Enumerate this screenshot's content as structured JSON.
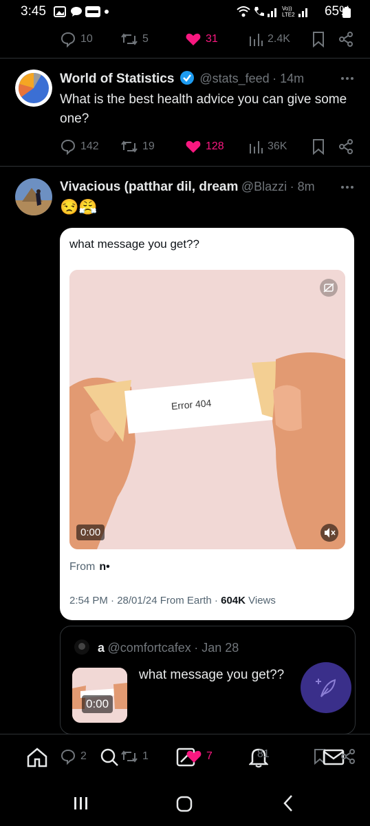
{
  "status_bar": {
    "time": "3:45",
    "battery": "65%"
  },
  "prev_tweet_actions": {
    "replies": "10",
    "retweets": "5",
    "likes": "31",
    "views": "2.4K"
  },
  "tweet1": {
    "name": "World of Statistics",
    "handle": "@stats_feed",
    "time": "· 14m",
    "text": "What is the best health advice you can give some one?",
    "replies": "142",
    "retweets": "19",
    "likes": "128",
    "views": "36K"
  },
  "tweet2": {
    "name": "Vivacious (patthar dil, dream",
    "handle": "@Blazzi",
    "time": "· 8m",
    "emoji": "😒😤",
    "card": {
      "message": "what message you get??",
      "error_text": "Error 404",
      "video_time": "0:00",
      "from_label": "From",
      "from_value": "n•",
      "meta_prefix": "2:54 PM · 28/01/24 From Earth ·",
      "views_count": "604K",
      "views_label": "Views"
    },
    "quote": {
      "name": "a",
      "handle": "@comfortcafex",
      "time": "· Jan 28",
      "text": "what message you get??",
      "video_time": "0:00"
    },
    "actions": {
      "replies": "2",
      "retweets": "1",
      "likes": "7",
      "views": "81"
    }
  },
  "colors": {
    "like": "#f91880",
    "verified": "#1d9bf0",
    "fab": "#3a2f8a"
  }
}
